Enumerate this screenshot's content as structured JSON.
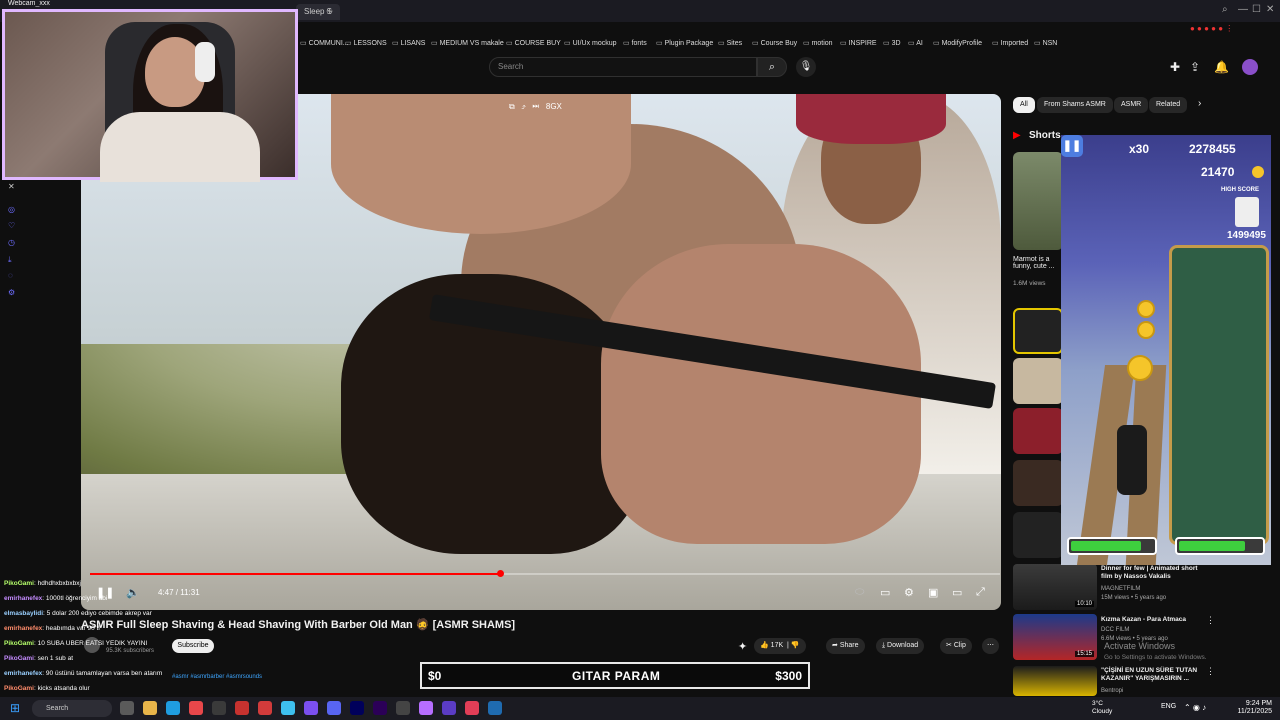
{
  "browser": {
    "tab_label": "Sleep S",
    "bookmarks": [
      "COMMUNI...",
      "LESSONS",
      "LISANS",
      "MEDIUM VS makale",
      "COURSE BUY",
      "UI/Ux mockup",
      "fonts",
      "Plugin Package",
      "Sites",
      "Course Buy",
      "motion",
      "INSPIRE",
      "3D",
      "AI",
      "ModifyProfile",
      "Imported",
      "NSN"
    ]
  },
  "webcam": {
    "title": "Webcam_xxx"
  },
  "header": {
    "search_placeholder": "Search"
  },
  "video": {
    "top_controls_label": "8GX",
    "time": "4:47 / 11:31",
    "progress_fraction": 0.45,
    "title": "ASMR Full Sleep Shaving & Head Shaving With Barber Old Man 🧔 [ASMR SHAMS]",
    "subscribe_label": "Subscribe",
    "subscribers": "95.3K subscribers",
    "hashtags": "#asmr #asmrbarber #asmrsounds"
  },
  "actions": {
    "likes": "17K",
    "share": "Share",
    "download": "Download",
    "clip": "Clip"
  },
  "donation": {
    "left": "$0",
    "middle": "GITAR PARAM",
    "right": "$300"
  },
  "chat": [
    {
      "user": "PikoGami",
      "msg": "hdhdhxbxbxbxj"
    },
    {
      "user": "emirhanefex",
      "msg": "1000tl öğrenciyim abi"
    },
    {
      "user": "elmasbaylidi",
      "msg": "5 dolar 200 ediyo cebimde akrep var"
    },
    {
      "user": "emirhanefex",
      "msg": "heabımda var 90 tl"
    },
    {
      "user": "PikoGami",
      "msg": "10 SUBA UBER EATSI YEDIK YAYINI"
    },
    {
      "user": "PikoGami",
      "msg": "sen 1 sub at"
    },
    {
      "user": "emirhanefex",
      "msg": "90 üstünü tamamlayan varsa ben atarım"
    },
    {
      "user": "PikoGami",
      "msg": "kicks atsanda olur"
    }
  ],
  "sidebar_right": {
    "chips": [
      "All",
      "From Shams ASMR",
      "ASMR",
      "Related"
    ],
    "shorts_label": "Shorts",
    "short1_title": "Marmot is a funny, cute ...",
    "short1_views": "1.6M views",
    "recs": [
      {
        "title": "Dinner for few | Animated short film by Nassos Vakalis",
        "channel": "MAGNETFILM",
        "meta": "15M views • 5 years ago",
        "duration": "10:10"
      },
      {
        "title": "Kızma Kazan - Para Atmaca",
        "channel": "DCC FILM",
        "meta": "6.6M views • 5 years ago",
        "duration": "15:15"
      },
      {
        "title": "\"ÇİŞİNİ EN UZUN SÜRE TUTAN KAZANIR\" YARIŞMASIRIN ...",
        "channel": "Bentropi",
        "meta": "",
        "duration": ""
      }
    ]
  },
  "game": {
    "multiplier": "x30",
    "score": "2278455",
    "coins": "21470",
    "high_score_label": "HIGH SCORE",
    "high_score": "1499495",
    "power_left": 0.85,
    "power_right": 0.8
  },
  "activate": {
    "title": "Activate Windows",
    "sub": "Go to Settings to activate Windows."
  },
  "taskbar": {
    "search": "Search",
    "weather_temp": "3°C",
    "weather_desc": "Cloudy",
    "lang": "ENG",
    "time": "9:24 PM",
    "date": "11/21/2025"
  },
  "colors": {
    "accent": "#ff0000",
    "webcam_border": "#e0b8ff"
  }
}
